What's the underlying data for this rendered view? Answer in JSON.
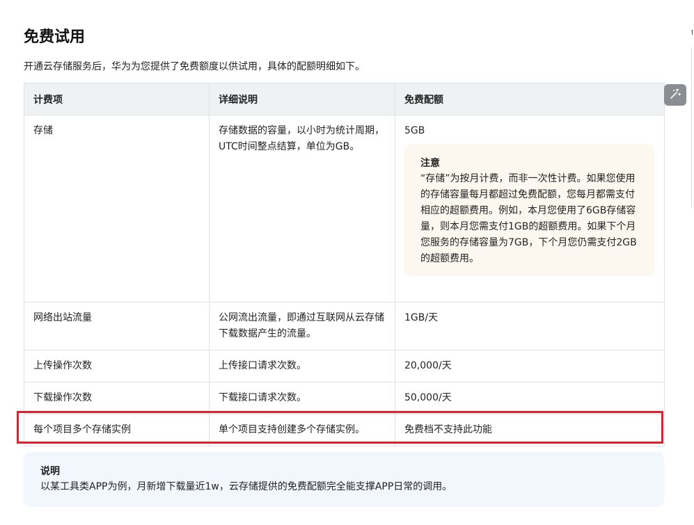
{
  "page": {
    "title": "免费试用",
    "intro": "开通云存储服务后，华为为您提供了免费额度以供试用，具体的配额明细如下。"
  },
  "table": {
    "headers": [
      "计费项",
      "详细说明",
      "免费配额"
    ],
    "rows": [
      {
        "item": "存储",
        "detail": "存储数据的容量，以小时为统计周期，UTC时间整点结算，单位为GB。",
        "quota": "5GB",
        "note": {
          "title": "注意",
          "text": "“存储”为按月计费，而非一次性计费。如果您使用的存储容量每月都超过免费配额，您每月都需支付相应的超额费用。例如，本月您使用了6GB存储容量，则本月您需支付1GB的超额费用。如果下个月您服务的存储容量为7GB，下个月您仍需支付2GB的超额费用。"
        }
      },
      {
        "item": "网络出站流量",
        "detail": "公网流出流量，即通过互联网从云存储下载数据产生的流量。",
        "quota": "1GB/天"
      },
      {
        "item": "上传操作次数",
        "detail": "上传接口请求次数。",
        "quota": "20,000/天"
      },
      {
        "item": "下载操作次数",
        "detail": "下载接口请求次数。",
        "quota": "50,000/天"
      },
      {
        "item": "每个项目多个存储实例",
        "detail": "单个项目支持创建多个存储实例。",
        "quota": "免费档不支持此功能"
      }
    ]
  },
  "info": {
    "title": "说明",
    "text": "以某工具类APP为例，月新增下载量近1w，云存储提供的免费配额完全能支撑APP日常的调用。"
  },
  "side_tools": {
    "ai_button_icon": "magic-wand-icon"
  },
  "colors": {
    "highlight": "#e0202a",
    "note_background": "#fcf8f0",
    "info_background": "#f2f6fd",
    "header_background": "#f0f1f3"
  }
}
